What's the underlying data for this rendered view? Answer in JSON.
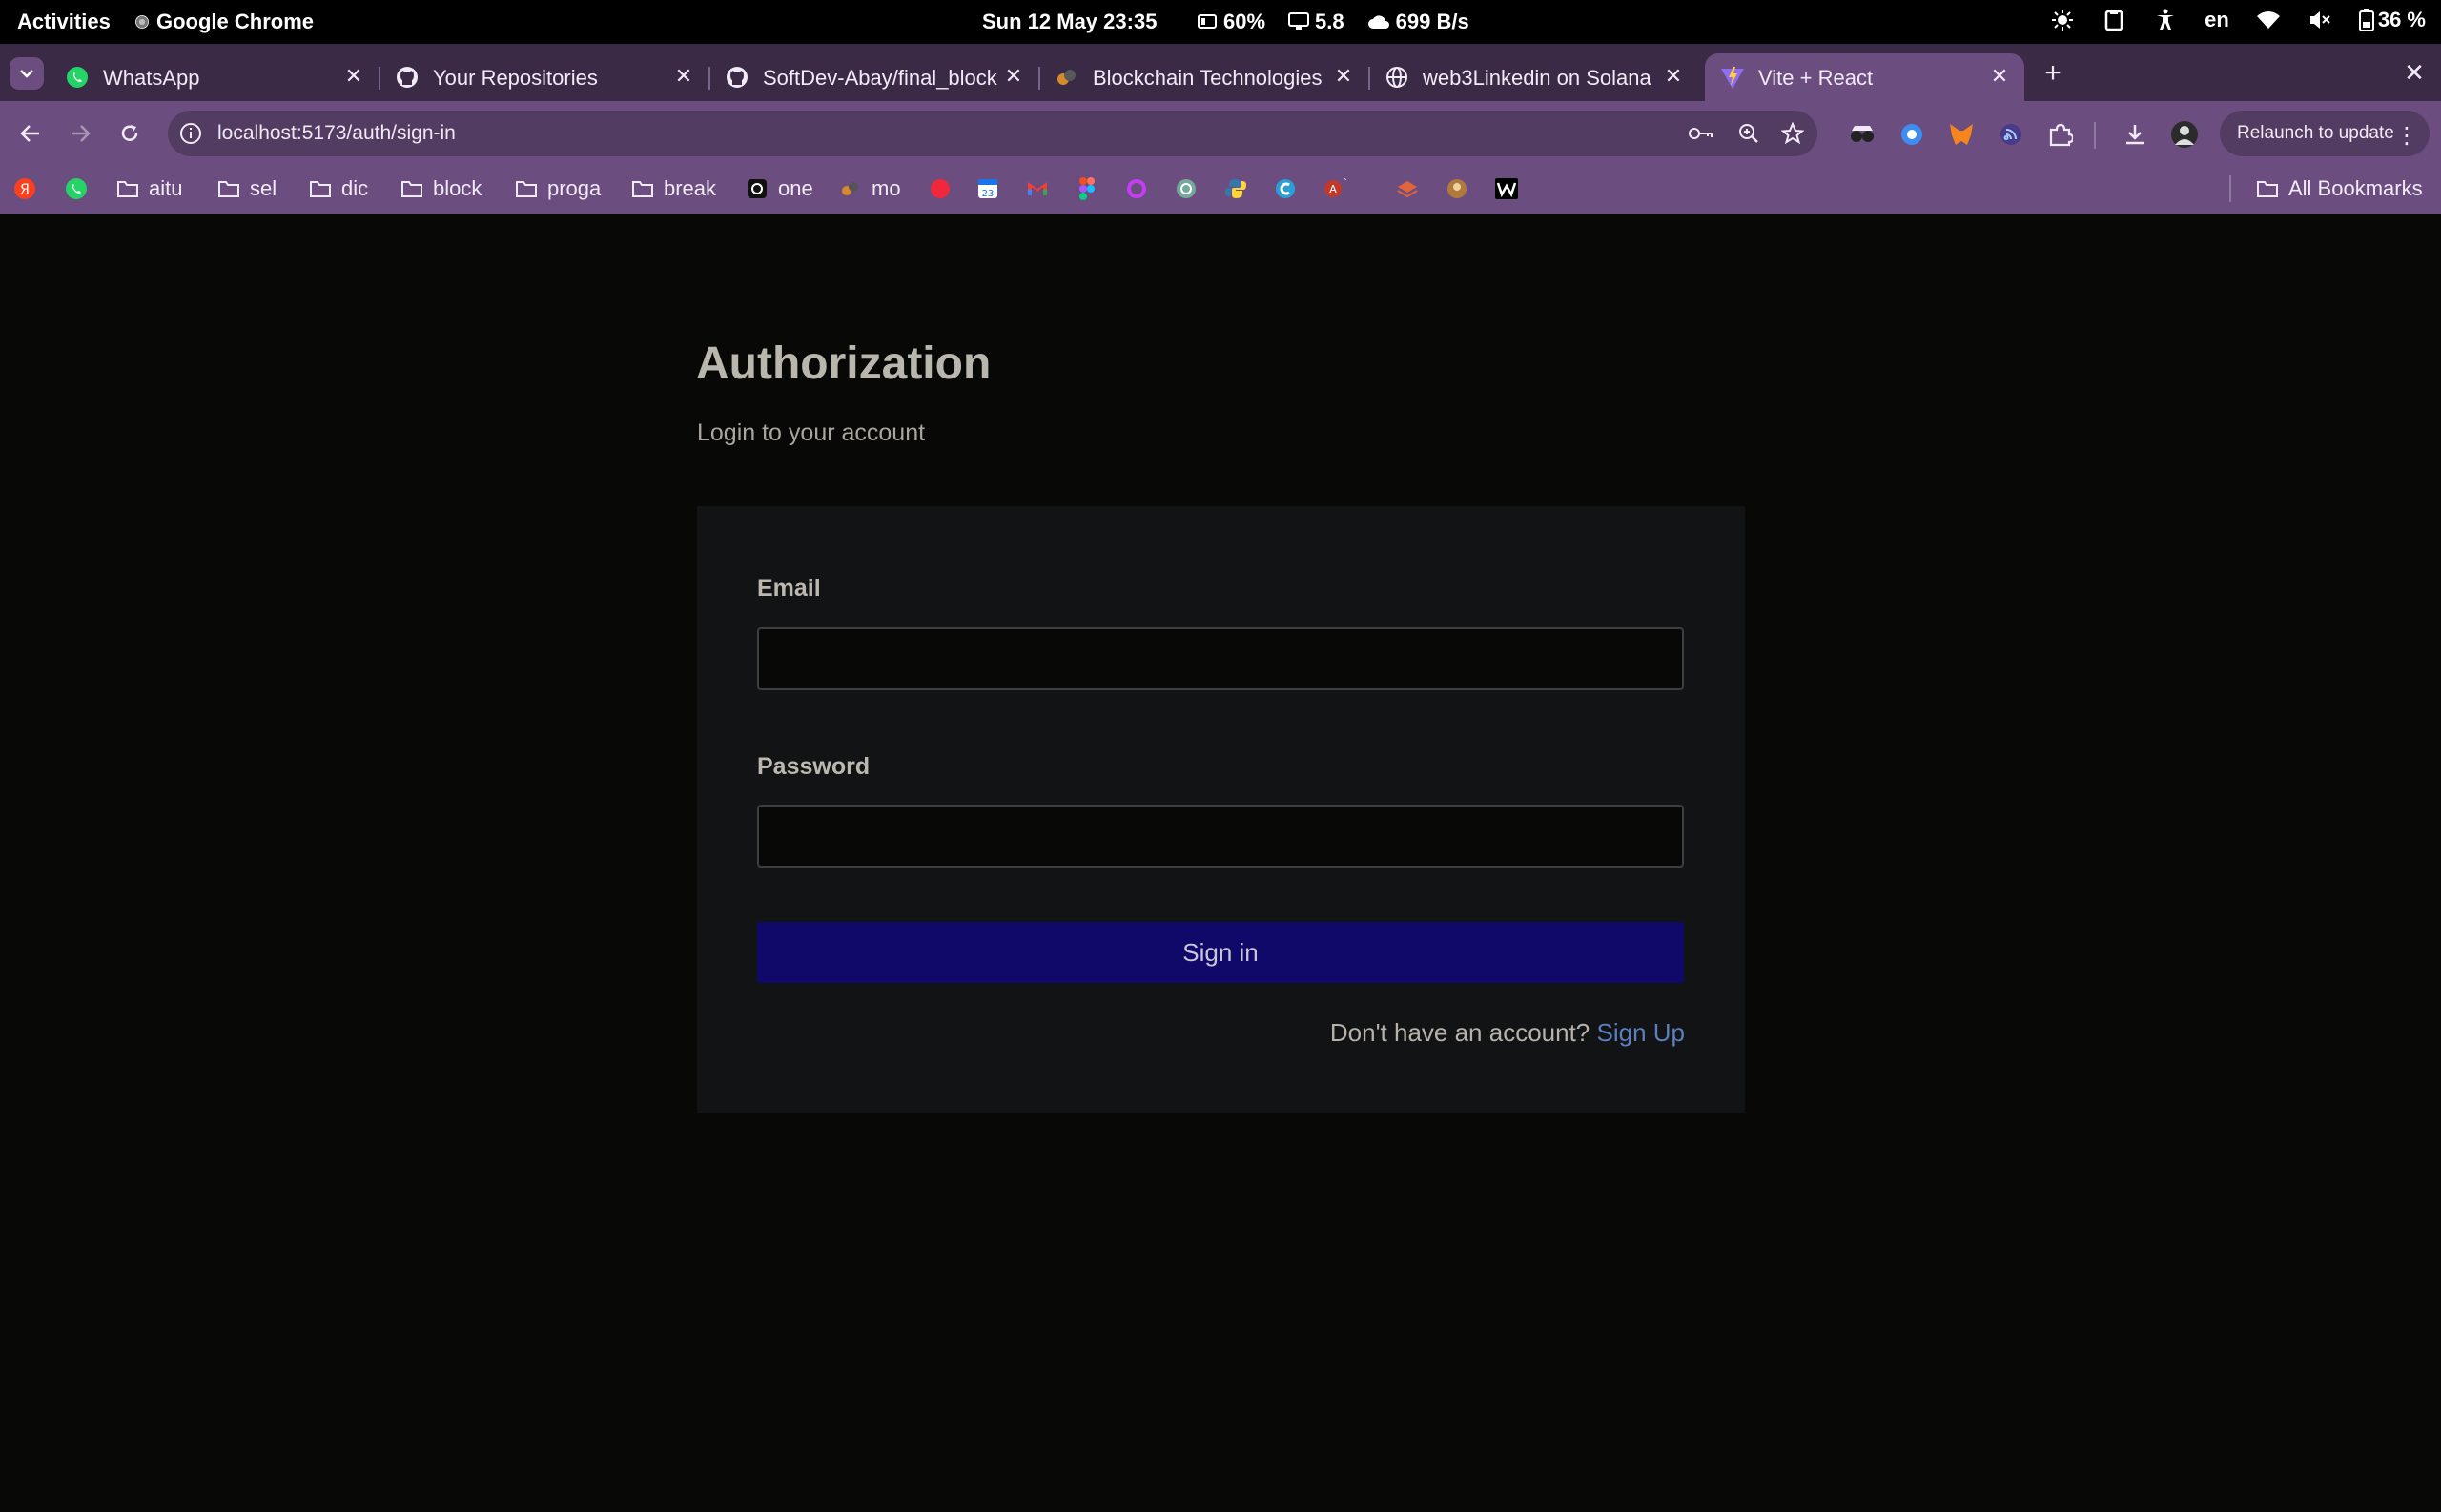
{
  "system_bar": {
    "activities": "Activities",
    "app_name": "Google Chrome",
    "datetime": "Sun 12 May  23:35",
    "cpu": "60%",
    "load": "5.8",
    "network": "699 B/s",
    "language": "en",
    "battery": "36 %"
  },
  "browser": {
    "tabs": [
      {
        "title": "WhatsApp",
        "icon": "whatsapp-icon",
        "active": false
      },
      {
        "title": "Your Repositories",
        "icon": "github-icon",
        "active": false
      },
      {
        "title": "SoftDev-Abay/final_block",
        "icon": "github-icon",
        "active": false
      },
      {
        "title": "Blockchain Technologies",
        "icon": "moodle-icon",
        "active": false
      },
      {
        "title": "web3Linkedin on Solana",
        "icon": "globe-icon",
        "active": false
      },
      {
        "title": "Vite + React",
        "icon": "vite-icon",
        "active": true
      }
    ],
    "url": "localhost:5173/auth/sign-in",
    "relaunch_label": "Relaunch to update",
    "bookmarks": [
      {
        "label": "",
        "icon": "yandex-icon"
      },
      {
        "label": "",
        "icon": "whatsapp-icon"
      },
      {
        "label": "aitu",
        "icon": "folder-icon"
      },
      {
        "label": "sel",
        "icon": "folder-icon"
      },
      {
        "label": "dic",
        "icon": "folder-icon"
      },
      {
        "label": "block",
        "icon": "folder-icon"
      },
      {
        "label": "proga",
        "icon": "folder-icon"
      },
      {
        "label": "break",
        "icon": "folder-icon"
      },
      {
        "label": "one",
        "icon": "app-icon"
      },
      {
        "label": "mo",
        "icon": "app-icon"
      }
    ],
    "all_bookmarks_label": "All Bookmarks"
  },
  "auth": {
    "title": "Authorization",
    "subtitle": "Login to your account",
    "email_label": "Email",
    "email_value": "",
    "password_label": "Password",
    "password_value": "",
    "sign_in_label": "Sign in",
    "no_account_text": "Don't have an account?",
    "sign_up_label": "Sign Up"
  },
  "colors": {
    "page_bg": "#080807",
    "card_bg": "#121314",
    "button_bg": "#11096a",
    "link": "#5c7fbf",
    "chrome_frame": "#6b4d80"
  }
}
